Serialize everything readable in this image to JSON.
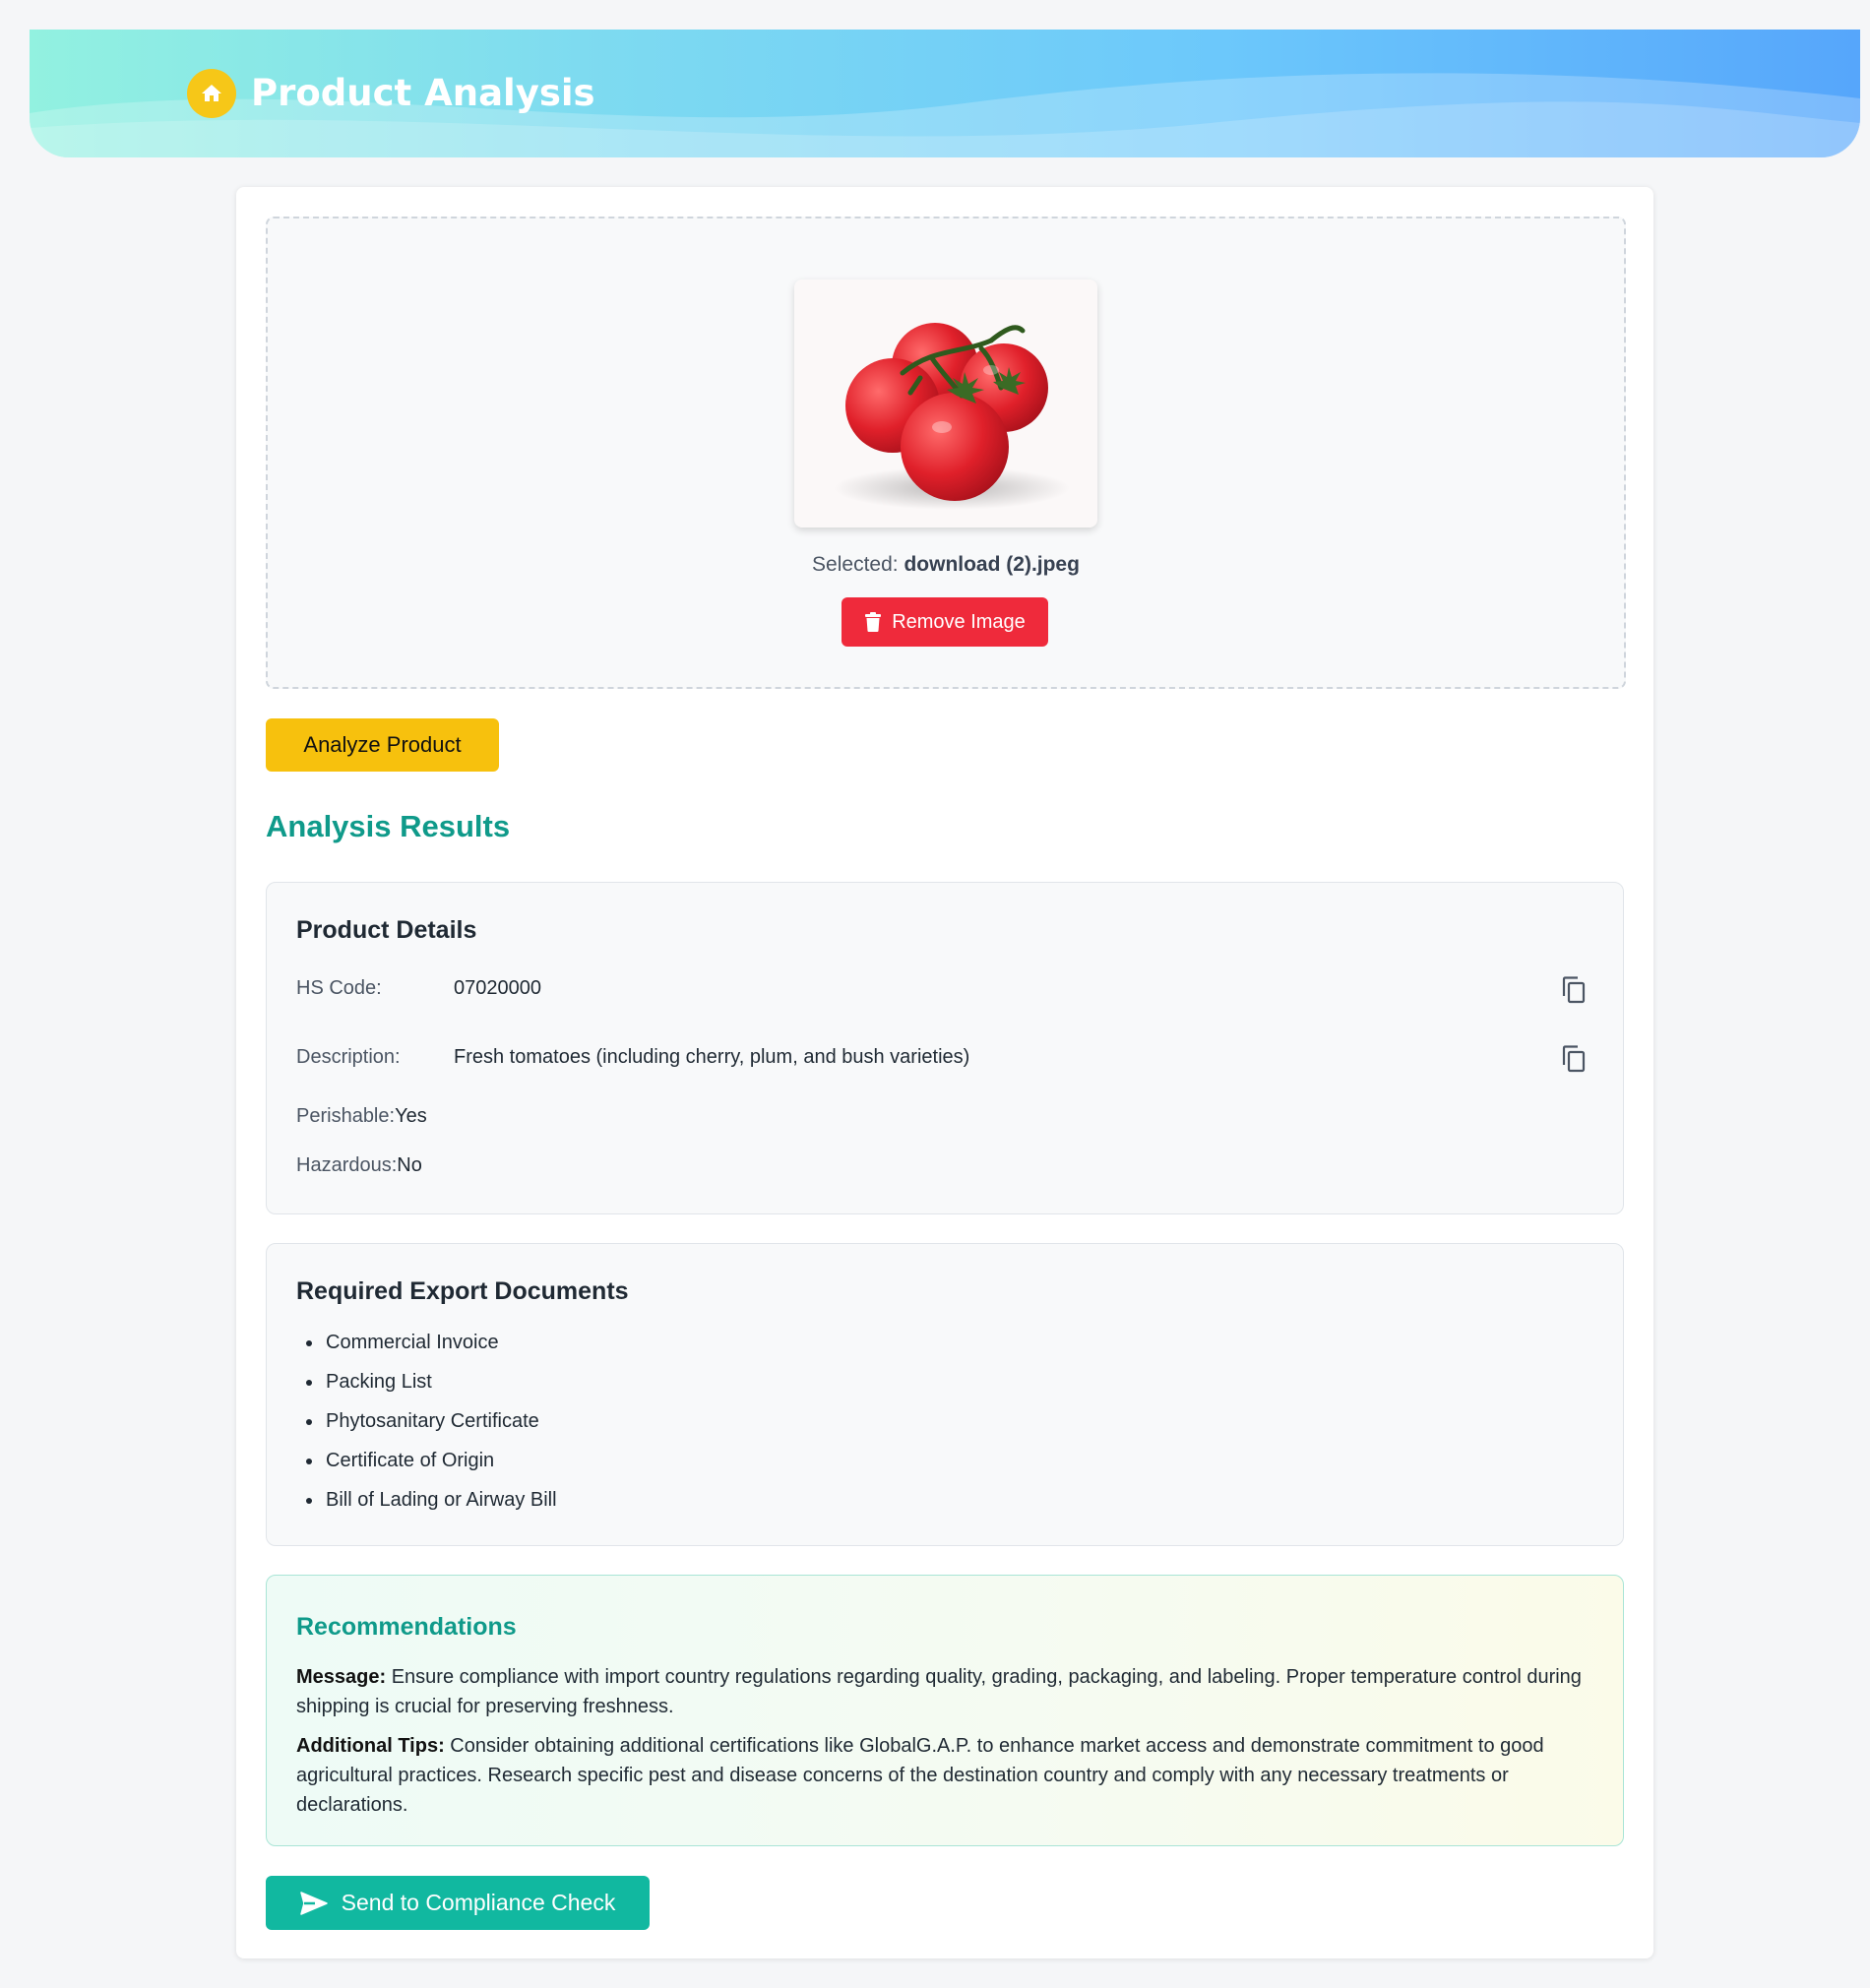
{
  "header": {
    "title": "Product Analysis",
    "icon": "home-icon",
    "accent": "#f6c718"
  },
  "upload": {
    "selected_prefix": "Selected:",
    "filename": "download (2).jpeg",
    "remove_label": "Remove Image",
    "remove_icon": "trash-icon"
  },
  "analyze_label": "Analyze Product",
  "results": {
    "title": "Analysis Results",
    "product_details": {
      "title": "Product Details",
      "hs_code_label": "HS Code:",
      "hs_code": "07020000",
      "description_label": "Description:",
      "description": "Fresh tomatoes (including cherry, plum, and bush varieties)",
      "perishable_label": "Perishable:",
      "perishable": "Yes",
      "hazardous_label": "Hazardous:",
      "hazardous": "No"
    },
    "export_docs": {
      "title": "Required Export Documents",
      "items": [
        "Commercial Invoice",
        "Packing List",
        "Phytosanitary Certificate",
        "Certificate of Origin",
        "Bill of Lading or Airway Bill"
      ]
    },
    "recommendations": {
      "title": "Recommendations",
      "message_label": "Message:",
      "message": "Ensure compliance with import country regulations regarding quality, grading, packaging, and labeling. Proper temperature control during shipping is crucial for preserving freshness.",
      "tips_label": "Additional Tips:",
      "tips": "Consider obtaining additional certifications like GlobalG.A.P. to enhance market access and demonstrate commitment to good agricultural practices. Research specific pest and disease concerns of the destination country and comply with any necessary treatments or declarations."
    }
  },
  "send_label": "Send to Compliance Check",
  "colors": {
    "brand_teal": "#0f9a8a",
    "send_button": "#11b8a0",
    "remove_button": "#ef2a3b",
    "analyze_button": "#f7c10d"
  }
}
